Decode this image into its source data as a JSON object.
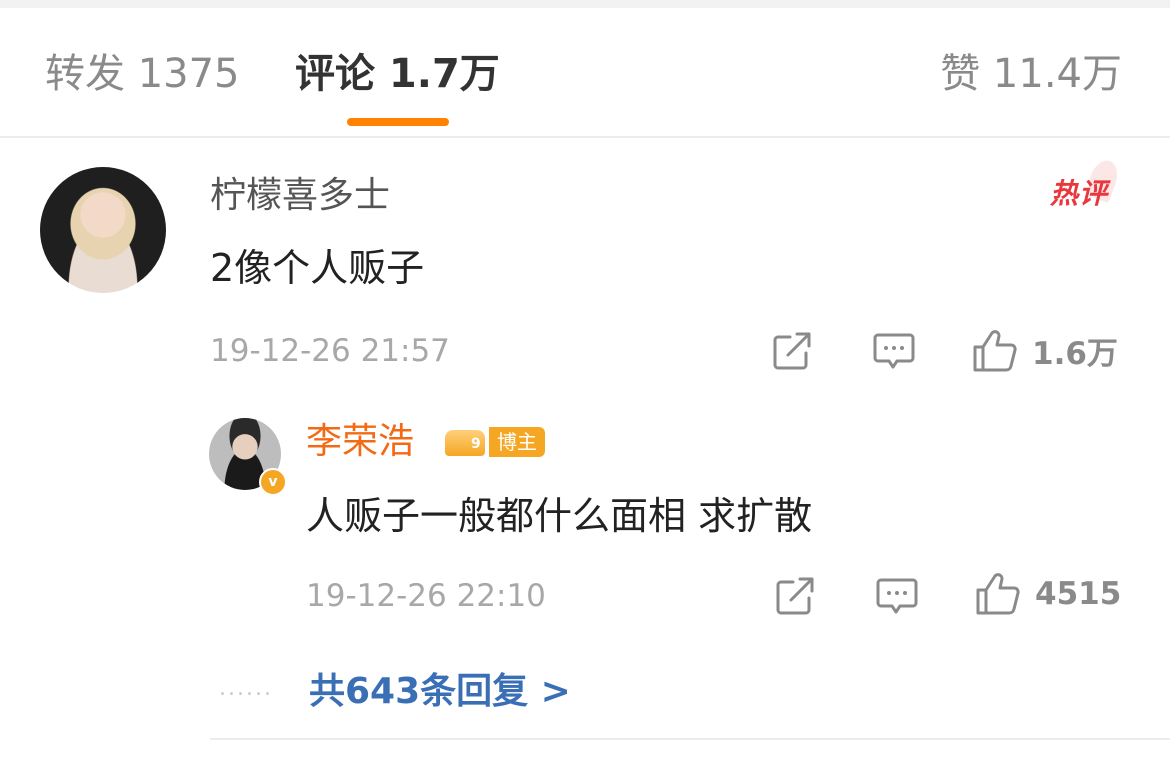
{
  "tabs": {
    "repost": "转发 1375",
    "comment": "评论 1.7万",
    "like": "赞 11.4万"
  },
  "comments": [
    {
      "username": "柠檬喜多士",
      "text": "2像个人贩子",
      "time": "19-12-26 21:57",
      "likes": "1.6万",
      "badge": "热评"
    }
  ],
  "reply": {
    "username": "李荣浩",
    "blogger_label": "博主",
    "crown_level": "9",
    "text": "人贩子一般都什么面相 求扩散",
    "time": "19-12-26 22:10",
    "likes": "4515",
    "more_replies": "共643条回复 >"
  },
  "colors": {
    "accent": "#ff8200",
    "blogger_name": "#f26b14",
    "link": "#3a6fb5",
    "hot": "#e8383d"
  },
  "icons": [
    "share-icon",
    "comment-icon",
    "like-icon",
    "verified-icon",
    "crown-icon"
  ]
}
